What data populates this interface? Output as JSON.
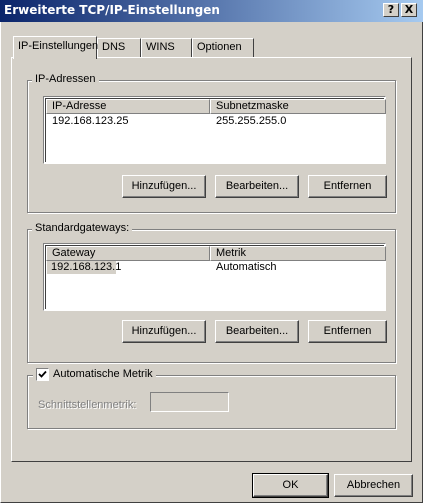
{
  "window": {
    "title": "Erweiterte TCP/IP-Einstellungen",
    "help_label": "?",
    "close_label": "X"
  },
  "tabs": [
    {
      "label": "IP-Einstellungen",
      "active": true
    },
    {
      "label": "DNS",
      "active": false
    },
    {
      "label": "WINS",
      "active": false
    },
    {
      "label": "Optionen",
      "active": false
    }
  ],
  "ip_group": {
    "title": "IP-Adressen",
    "columns": [
      "IP-Adresse",
      "Subnetzmaske"
    ],
    "rows": [
      {
        "ip": "192.168.123.25",
        "mask": "255.255.255.0"
      }
    ],
    "buttons": {
      "add": "Hinzufügen...",
      "edit": "Bearbeiten...",
      "remove": "Entfernen"
    }
  },
  "gateway_group": {
    "title": "Standardgateways:",
    "columns": [
      "Gateway",
      "Metrik"
    ],
    "rows": [
      {
        "gateway": "192.168.123.1",
        "metric": "Automatisch"
      }
    ],
    "buttons": {
      "add": "Hinzufügen...",
      "edit": "Bearbeiten...",
      "remove": "Entfernen"
    }
  },
  "metric_group": {
    "auto_metric_label": "Automatische Metrik",
    "auto_metric_checked": true,
    "interface_metric_label": "Schnittstellenmetrik:",
    "interface_metric_value": ""
  },
  "footer": {
    "ok_label": "OK",
    "cancel_label": "Abbrechen"
  }
}
